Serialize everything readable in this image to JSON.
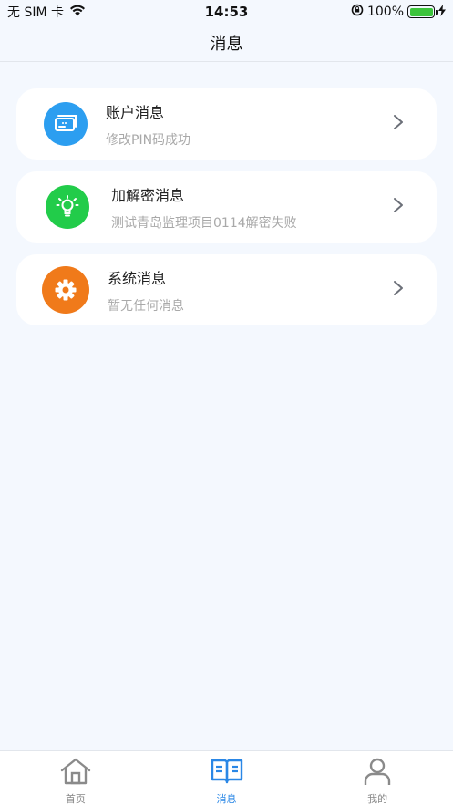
{
  "status_bar": {
    "carrier": "无 SIM 卡",
    "time": "14:53",
    "battery": "100%",
    "battery_level": 1.0
  },
  "nav": {
    "title": "消息"
  },
  "messages": [
    {
      "title": "账户消息",
      "subtitle": "修改PIN码成功",
      "icon": "account-card-icon",
      "color": "#2c9ef0"
    },
    {
      "title": "加解密消息",
      "subtitle": "测试青岛监理项目0114解密失败",
      "icon": "lightbulb-icon",
      "color": "#22cc4a"
    },
    {
      "title": "系统消息",
      "subtitle": "暂无任何消息",
      "icon": "gear-icon",
      "color": "#f07a1a"
    }
  ],
  "tabs": [
    {
      "label": "首页",
      "icon": "home-icon",
      "active": false
    },
    {
      "label": "消息",
      "icon": "book-icon",
      "active": true
    },
    {
      "label": "我的",
      "icon": "user-icon",
      "active": false
    }
  ],
  "colors": {
    "accent": "#2a87e6",
    "background": "#f4f8fe"
  }
}
